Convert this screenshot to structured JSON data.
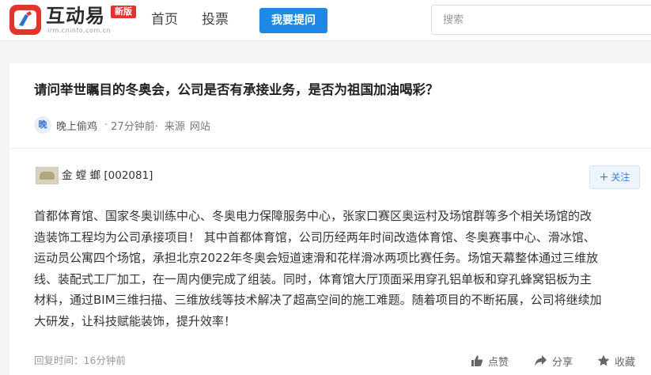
{
  "header": {
    "logo_text": "互动易",
    "logo_badge": "新版",
    "logo_sub": "irm.cninfo.com.cn",
    "nav": [
      "首页",
      "投票"
    ],
    "ask_button": "我要提问",
    "search_placeholder": "搜索"
  },
  "question": {
    "title": "请问举世瞩目的冬奥会，公司是否有承接业务，是否为祖国加油喝彩？",
    "avatar_char": "晚",
    "asker": "晚上偷鸡",
    "dot": "·",
    "time": "27分钟前·",
    "source_label": "来源",
    "source": "网站"
  },
  "answer": {
    "company": "金 螳 螂 [002081]",
    "follow_label": "关注",
    "lines": [
      "首都体育馆、国家冬奥训练中心、冬奥电力保障服务中心，张家口赛区奥运村及场馆群等多个相关场馆的改",
      "造装饰工程均为公司承接项目！ 其中首都体育馆，公司历经两年时间改造体育馆、冬奥赛事中心、滑冰馆、",
      "运动员公寓四个场馆，承担北京2022年冬奥会短道速滑和花样滑冰两项比赛任务。场馆天幕整体通过三维放",
      "线、装配式工厂加工，在一周内便完成了组装。同时，体育馆大厅顶面采用穿孔铝单板和穿孔蜂窝铝板为主",
      "材料，通过BIM三维扫描、三维放线等技术解决了超高空间的施工难题。随着项目的不断拓展，公司将继续加",
      "大研发，让科技赋能装饰，提升效率！"
    ],
    "reply_time": "回复时间：16分钟前",
    "actions": {
      "like": "点赞",
      "share": "分享",
      "favorite": "收藏"
    }
  },
  "colors": {
    "brand_red": "#e2332d",
    "primary_blue": "#1e88e5",
    "follow_blue": "#3d7fd6",
    "page_bg": "#f4f5f7"
  },
  "icons": [
    "app-logo-icon",
    "plus-icon",
    "thumbs-up-icon",
    "share-arrow-icon",
    "star-icon"
  ]
}
